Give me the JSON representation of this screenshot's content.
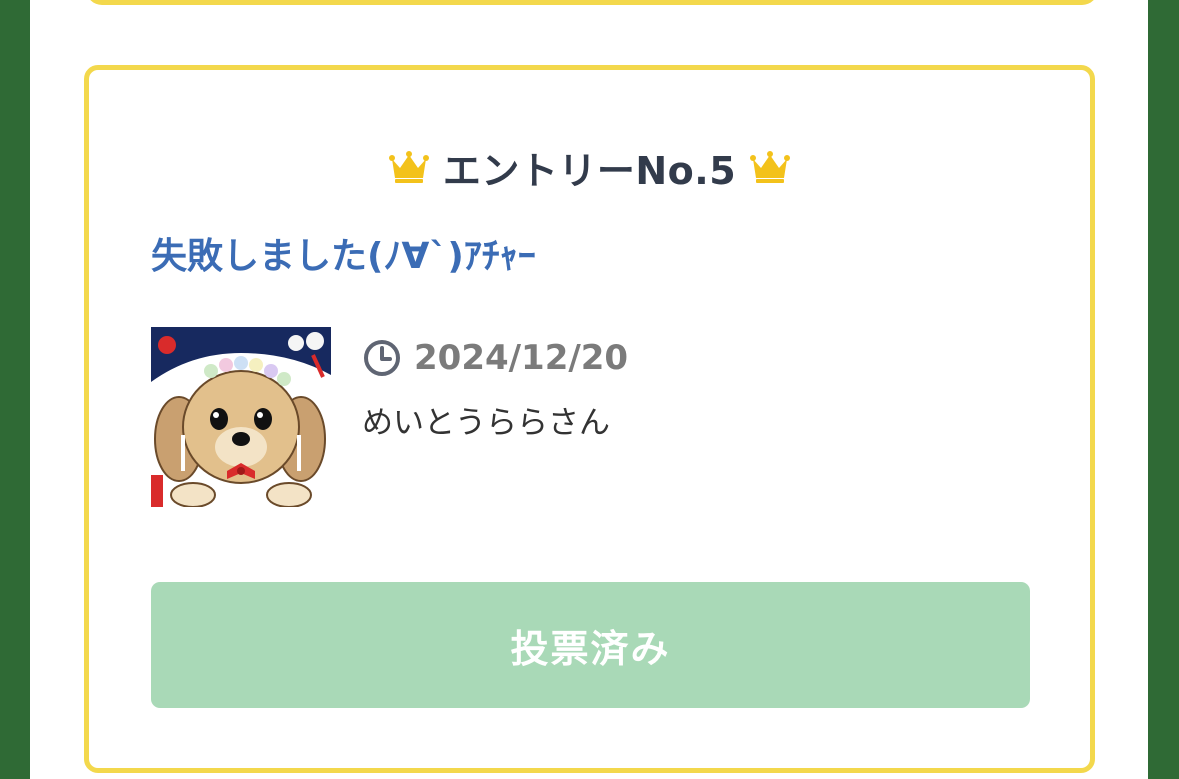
{
  "entry": {
    "heading": "エントリーNo.5",
    "crown_icon": "crown-icon",
    "crown_color": "#f3c21b",
    "title": "失敗しました(ﾉ∀`)ｱﾁｬｰ",
    "date_icon": "clock-icon",
    "date": "2024/12/20",
    "author": "めいとうららさん",
    "avatar_description_icon": "dog-avatar-image"
  },
  "vote_button": {
    "label": "投票済み",
    "state": "voted",
    "background": "#a9d9b7"
  },
  "colors": {
    "background_green": "#2f6a35",
    "card_border": "#f3d84c",
    "title_blue": "#3b6cb5",
    "heading_text": "#323b4b"
  }
}
